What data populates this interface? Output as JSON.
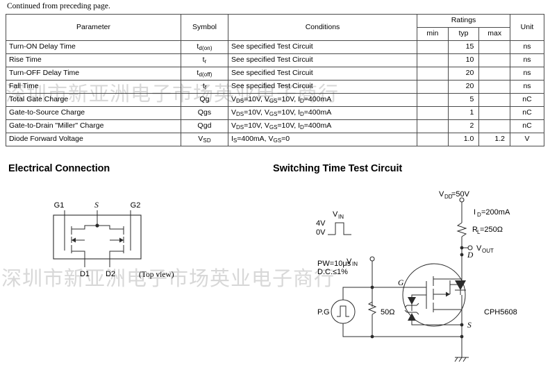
{
  "note": "Continued from preceding page.",
  "table": {
    "headers": {
      "parameter": "Parameter",
      "symbol": "Symbol",
      "conditions": "Conditions",
      "ratings": "Ratings",
      "min": "min",
      "typ": "typ",
      "max": "max",
      "unit": "Unit"
    },
    "rows": [
      {
        "parameter": "Turn-ON Delay Time",
        "symbol_base": "t",
        "symbol_sub": "d(on)",
        "conditions": "See specified Test Circuit",
        "min": "",
        "typ": "15",
        "max": "",
        "unit": "ns"
      },
      {
        "parameter": "Rise Time",
        "symbol_base": "t",
        "symbol_sub": "r",
        "conditions": "See specified Test Circuit",
        "min": "",
        "typ": "10",
        "max": "",
        "unit": "ns"
      },
      {
        "parameter": "Turn-OFF Delay Time",
        "symbol_base": "t",
        "symbol_sub": "d(off)",
        "conditions": "See specified Test Circuit",
        "min": "",
        "typ": "20",
        "max": "",
        "unit": "ns"
      },
      {
        "parameter": "Fall Time",
        "symbol_base": "t",
        "symbol_sub": "f",
        "conditions": "See specified Test Circuit",
        "min": "",
        "typ": "20",
        "max": "",
        "unit": "ns"
      },
      {
        "parameter": "Total Gate Charge",
        "symbol_base": "Qg",
        "symbol_sub": "",
        "conditions": "VDS=10V, VGS=10V, ID=400mA",
        "min": "",
        "typ": "5",
        "max": "",
        "unit": "nC"
      },
      {
        "parameter": "Gate-to-Source Charge",
        "symbol_base": "Qgs",
        "symbol_sub": "",
        "conditions": "VDS=10V, VGS=10V, ID=400mA",
        "min": "",
        "typ": "1",
        "max": "",
        "unit": "nC"
      },
      {
        "parameter": "Gate-to-Drain \"Miller\" Charge",
        "symbol_base": "Qgd",
        "symbol_sub": "",
        "conditions": "VDS=10V, VGS=10V, ID=400mA",
        "min": "",
        "typ": "2",
        "max": "",
        "unit": "nC"
      },
      {
        "parameter": "Diode Forward Voltage",
        "symbol_base": "V",
        "symbol_sub": "SD",
        "conditions": "IS=400mA, VGS=0",
        "min": "",
        "typ": "1.0",
        "max": "1.2",
        "unit": "V"
      }
    ]
  },
  "sections": {
    "electrical_connection": {
      "title": "Electrical Connection",
      "labels": {
        "g1": "G1",
        "s": "S",
        "g2": "G2",
        "d1": "D1",
        "d2": "D2",
        "view": "(Top view)"
      }
    },
    "switching_time_test_circuit": {
      "title": "Switching Time Test Circuit",
      "labels": {
        "vdd": "V",
        "vdd_sub": "DD",
        "vdd_val": "=50V",
        "id": "I",
        "id_sub": "D",
        "id_val": "=200mA",
        "rl": "R",
        "rl_sub": "L",
        "rl_val": "=250Ω",
        "vout": "V",
        "vout_sub": "OUT",
        "vin_wave": "V",
        "vin_wave_sub": "IN",
        "level_high": "4V",
        "level_low": "0V",
        "vin_node": "V",
        "vin_node_sub": "IN",
        "pw": "PW=10μs",
        "dc": "D.C.≤1%",
        "pg": "P.G",
        "rg": "50Ω",
        "node_d": "D",
        "node_g": "G",
        "node_s": "S",
        "part": "CPH5608"
      }
    }
  },
  "watermarks": {
    "top": "深圳市新亚洲电子市场英业电子商行",
    "bottom": "深圳市新亚洲电子市场英业电子商行"
  },
  "colors": {
    "rule": "#4a4a4a",
    "wire": "#2b2b2b",
    "watermark": "#d8d8d8"
  }
}
